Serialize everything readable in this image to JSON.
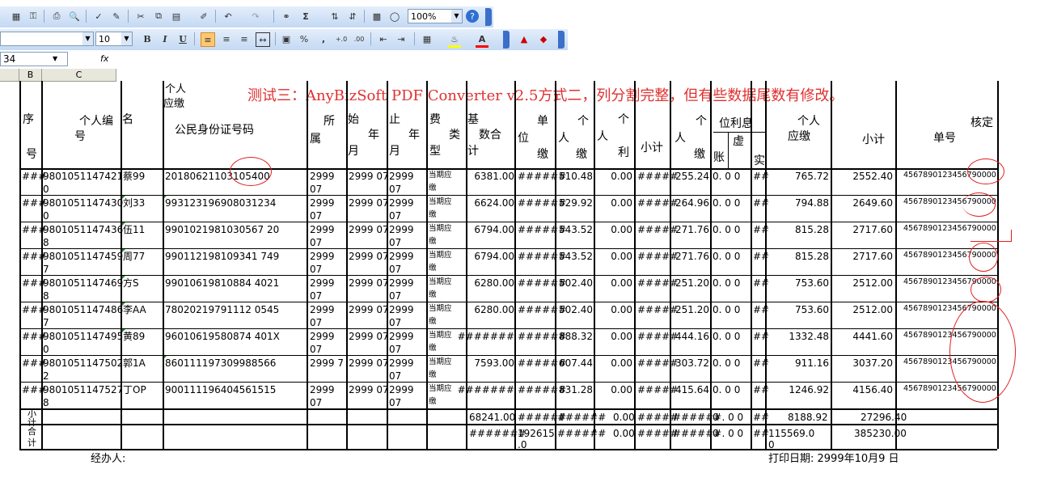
{
  "toolbar": {
    "zoom": "100%",
    "font_size": "10",
    "bold": "B",
    "italic": "I",
    "underline": "U",
    "percent": "%",
    "comma": ",",
    "sigma": "Σ"
  },
  "formula_bar": {
    "name_box": "34",
    "fx": "fx"
  },
  "column_headers": [
    "B",
    "C"
  ],
  "annotation": "测试三：AnyBizSoft PDF Converter v2.5方式二，列分割完整，但有些数据尾数有修改。",
  "sheet": {
    "top_label": [
      "个人",
      "应缴"
    ],
    "headers": {
      "xu": "序",
      "hao": "号",
      "id_top": "个人编",
      "id_bottom": "号",
      "name": "名",
      "shenfen": "公民身份证号码",
      "suo": "所",
      "shu": "属",
      "shi": "始",
      "nian1": "年",
      "yue1": "月",
      "zhi": "止",
      "nian2": "年",
      "yue2": "月",
      "fei": "费",
      "lei": "类",
      "xing": "型",
      "ji": "基",
      "shuhe": "数合",
      "ji2": "计",
      "dan": "单",
      "wei": "位",
      "jiao1": "缴",
      "ge1": "个",
      "ren1": "人",
      "jiao2": "缴",
      "ge2": "个",
      "ren2": "人",
      "li": "利",
      "xiaoji": "小计",
      "ge3": "个",
      "ren3": "人",
      "jiao3": "缴",
      "weilixi": "位利息",
      "xu2": "虚",
      "zhang": "账",
      "shi2": "实",
      "grjy_top": "个人",
      "grjy_bottom": "应缴",
      "xiaoji2": "小计",
      "hedin": "核定",
      "danhao": "单号"
    },
    "rows": [
      {
        "seq": "###",
        "pid1": "9801051147421",
        "pid2": "0",
        "name": "蔡99",
        "idno": "20180621103105400",
        "suo1": "2999",
        "suo2": "07",
        "start": "2999 07",
        "end1": "2999",
        "end2": "07",
        "fee1": "当期应",
        "fee2": "缴",
        "base": "6381.00",
        "unit": "######",
        "pers": "510.48",
        "interest": "0.00",
        "sub": "#####",
        "pers2": "255.24",
        "wli": "0. 0 0",
        "shi": "##",
        "due": "765.72",
        "subtotal": "2552.40",
        "order": "4567890123456790000"
      },
      {
        "seq": "###",
        "pid1": "9801051147430",
        "pid2": "0",
        "name": "刘33",
        "idno": "993123196908031234",
        "suo1": "2999",
        "suo2": "07",
        "start": "2999 07",
        "end1": "2999",
        "end2": "07",
        "fee1": "当期应",
        "fee2": "缴",
        "base": "6624.00",
        "unit": "######",
        "pers": "529.92",
        "interest": "0.00",
        "sub": "#####",
        "pers2": "264.96",
        "wli": "0. 0 0",
        "shi": "##",
        "due": "794.88",
        "subtotal": "2649.60",
        "order": "4567890123456790000"
      },
      {
        "seq": "###",
        "pid1": "9801051147436",
        "pid2": "8",
        "name": "伍11",
        "idno": "9901021981030567 20",
        "suo1": "2999",
        "suo2": "07",
        "start": "2999 07",
        "end1": "2999",
        "end2": "07",
        "fee1": "当期应",
        "fee2": "缴",
        "base": "6794.00",
        "unit": "######",
        "pers": "543.52",
        "interest": "0.00",
        "sub": "#####",
        "pers2": "271.76",
        "wli": "0. 0 0",
        "shi": "##",
        "due": "815.28",
        "subtotal": "2717.60",
        "order": "4567890123456790000"
      },
      {
        "seq": "###",
        "pid1": "9801051147459",
        "pid2": "7",
        "name": "周77",
        "idno": "990112198109341 749",
        "suo1": "2999",
        "suo2": "07",
        "start": "2999 07",
        "end1": "2999",
        "end2": "07",
        "fee1": "当期应",
        "fee2": "缴",
        "base": "6794.00",
        "unit": "######",
        "pers": "543.52",
        "interest": "0.00",
        "sub": "#####",
        "pers2": "271.76",
        "wli": "0. 0 0",
        "shi": "##",
        "due": "815.28",
        "subtotal": "2717.60",
        "order": "4567890123456790000"
      },
      {
        "seq": "###",
        "pid1": "9801051147469",
        "pid2": "8",
        "name": "方S",
        "idno": "99010619810884 4021",
        "suo1": "2999",
        "suo2": "07",
        "start": "2999 07",
        "end1": "2999",
        "end2": "07",
        "fee1": "当期应",
        "fee2": "缴",
        "base": "6280.00",
        "unit": "######",
        "pers": "502.40",
        "interest": "0.00",
        "sub": "#####",
        "pers2": "251.20",
        "wli": "0. 0 0",
        "shi": "##",
        "due": "753.60",
        "subtotal": "2512.00",
        "order": "4567890123456790000"
      },
      {
        "seq": "###",
        "pid1": "9801051147486",
        "pid2": "7",
        "name": "李AA",
        "idno": "78020219791112 0545",
        "suo1": "2999",
        "suo2": "07",
        "start": "2999 07",
        "end1": "2999",
        "end2": "07",
        "fee1": "当期应",
        "fee2": "缴",
        "base": "6280.00",
        "unit": "######",
        "pers": "502.40",
        "interest": "0.00",
        "sub": "#####",
        "pers2": "251.20",
        "wli": "0. 0 0",
        "shi": "##",
        "due": "753.60",
        "subtotal": "2512.00",
        "order": "4567890123456790000"
      },
      {
        "seq": "###",
        "pid1": "9801051147495",
        "pid2": "0",
        "name": "黄89",
        "idno": "96010619580874 401X",
        "suo1": "2999",
        "suo2": "07",
        "start": "2999 07",
        "end1": "2999",
        "end2": "07",
        "fee1": "当期应",
        "fee2": "缴",
        "base": "#######",
        "unit": "######",
        "pers": "888.32",
        "interest": "0.00",
        "sub": "#####",
        "pers2": "444.16",
        "wli": "0. 0 0",
        "shi": "##",
        "due": "1332.48",
        "subtotal": "4441.60",
        "order": "4567890123456790000"
      },
      {
        "seq": "###",
        "pid1": "9801051147502",
        "pid2": "2",
        "name": "郭1A",
        "idno": "860111197309988566",
        "suo1": "2999 7",
        "suo2": "",
        "start": "2999 07",
        "end1": "2999",
        "end2": "07",
        "fee1": "当期应",
        "fee2": "缴",
        "base": "7593.00",
        "unit": "######",
        "pers": "607.44",
        "interest": "0.00",
        "sub": "#####",
        "pers2": "303.72",
        "wli": "0. 0 0",
        "shi": "##",
        "due": "911.16",
        "subtotal": "3037.20",
        "order": "4567890123456790000"
      },
      {
        "seq": "###",
        "pid1": "9801051147527",
        "pid2": "8",
        "name": "丁OP",
        "idno": "900111196404561515",
        "suo1": "2999",
        "suo2": "07",
        "start": "2999 07",
        "end1": "2999",
        "end2": "07",
        "fee1": "当期应",
        "fee2": "缴",
        "base": "#######",
        "unit": "######",
        "pers": "831.28",
        "interest": "0.00",
        "sub": "#####",
        "pers2": "415.64",
        "wli": "0. 0 0",
        "shi": "##",
        "due": "1246.92",
        "subtotal": "4156.40",
        "order": "4567890123456790000"
      }
    ],
    "xiaoji_row": {
      "label1": "小",
      "label2": "计",
      "base": "68241.00",
      "unit": "######",
      "pers": "######",
      "interest": "0.00",
      "sub": "#####",
      "pers2": "######",
      "wli": "0 . 0 0",
      "shi": "##",
      "due": "8188.92",
      "subtotal": "27296.40"
    },
    "heji_row": {
      "label1": "合",
      "label2": "计",
      "base": "#######",
      "unit1": "192615",
      "unit2": ".0",
      "pers": "######",
      "interest": "0.00",
      "sub": "#####",
      "pers2": "######",
      "wli": "0 . 0 0",
      "shi": "##",
      "due1": "115569.0",
      "due2": "0",
      "subtotal": "385230.00"
    },
    "handler": "经办人:",
    "print_date": "打印日期:  2999年10月9 日"
  }
}
